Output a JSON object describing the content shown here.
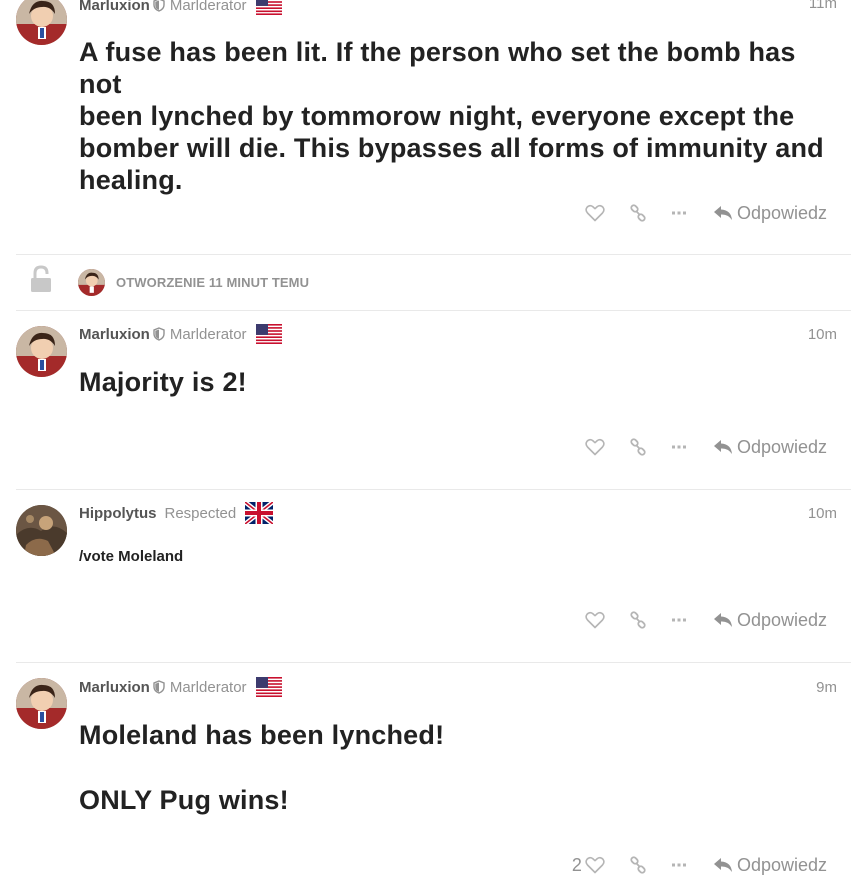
{
  "posts": [
    {
      "username": "Marluxion",
      "user_title": "Marlderator",
      "flag": "us-flag",
      "time": "11m",
      "body": [
        "A fuse has been lit. If the person who set the bomb has not",
        "been lynched by tommorow night, everyone except the",
        "bomber will die. This bypasses all forms of immunity and",
        "healing."
      ],
      "likes": "",
      "reply_label": "Odpowiedz"
    },
    {
      "username": "Marluxion",
      "user_title": "Marlderator",
      "flag": "us-flag",
      "time": "10m",
      "body": [
        "Majority is 2!"
      ],
      "likes": "",
      "reply_label": "Odpowiedz"
    },
    {
      "username": "Hippolytus",
      "user_title": "Respected",
      "flag": "uk-flag",
      "time": "10m",
      "body": [
        "/vote Moleland"
      ],
      "likes": "",
      "reply_label": "Odpowiedz"
    },
    {
      "username": "Marluxion",
      "user_title": "Marlderator",
      "flag": "us-flag",
      "time": "9m",
      "body": [
        "Moleland has been lynched!",
        "",
        "ONLY Pug wins!"
      ],
      "likes": "2",
      "reply_label": "Odpowiedz"
    }
  ],
  "small_action": {
    "icon": "unlock-icon",
    "text": "OTWORZENIE 11 MINUT TEMU"
  },
  "colors": {
    "muted": "#929292",
    "text": "#222222",
    "divider": "#e9e9e9"
  }
}
